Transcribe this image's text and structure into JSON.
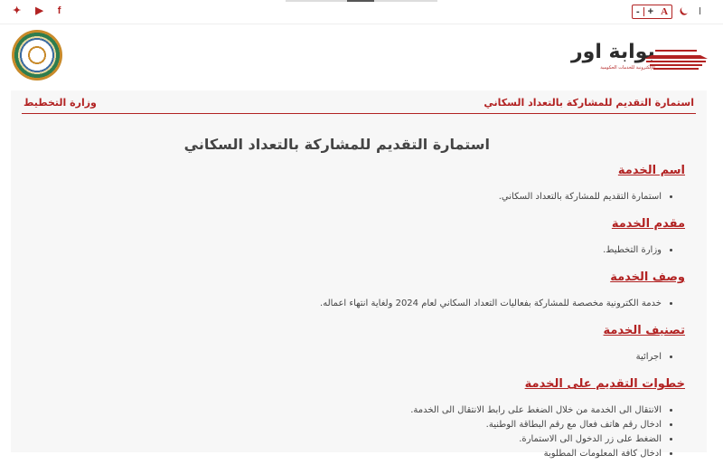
{
  "topbar": {
    "social": [
      {
        "icon": "facebook-icon",
        "glyph": "f"
      },
      {
        "icon": "youtube-icon",
        "glyph": "▶"
      },
      {
        "icon": "twitter-icon",
        "glyph": "✦"
      }
    ],
    "font_controls": {
      "minus": "-",
      "plus": "+",
      "font": "A"
    },
    "dark_mode_icon": "moon-icon"
  },
  "header": {
    "logo_main": "بوابة اور",
    "logo_sub": "الإلكترونية للخدمات الحكومية",
    "emblem_icon": "ministry-emblem-icon"
  },
  "breadcrumb": {
    "current": "استمارة التقديم للمشاركة بالتعداد السكاني",
    "ministry": "وزارة التخطيط"
  },
  "main": {
    "title": "استمارة التقديم للمشاركة بالتعداد السكاني",
    "sections": [
      {
        "heading": "اسم الخدمة",
        "items": [
          "استمارة التقديم للمشاركة بالتعداد السكاني."
        ]
      },
      {
        "heading": "مقدم الخدمة",
        "items": [
          "وزارة التخطيط."
        ]
      },
      {
        "heading": "وصف الخدمة",
        "items": [
          "خدمة الكترونية مخصصة للمشاركة بفعاليات التعداد السكاني لعام 2024 ولغاية انتهاء اعماله."
        ]
      },
      {
        "heading": "تصنيف الخدمة",
        "items": [
          "اجرائية"
        ]
      },
      {
        "heading": "خطوات التقديم على الخدمة",
        "items": [
          "الانتقال الى الخدمة من خلال الضغط على رابط الانتقال الى الخدمة.",
          "ادخال رقم هاتف فعال مع رقم البطاقة الوطنية.",
          "الضغط على زر الدخول الى الاستمارة.",
          "ادخال كافة المعلومات المطلوبة"
        ]
      }
    ]
  },
  "colors": {
    "accent": "#b22222",
    "panel": "#f7f7f7"
  }
}
